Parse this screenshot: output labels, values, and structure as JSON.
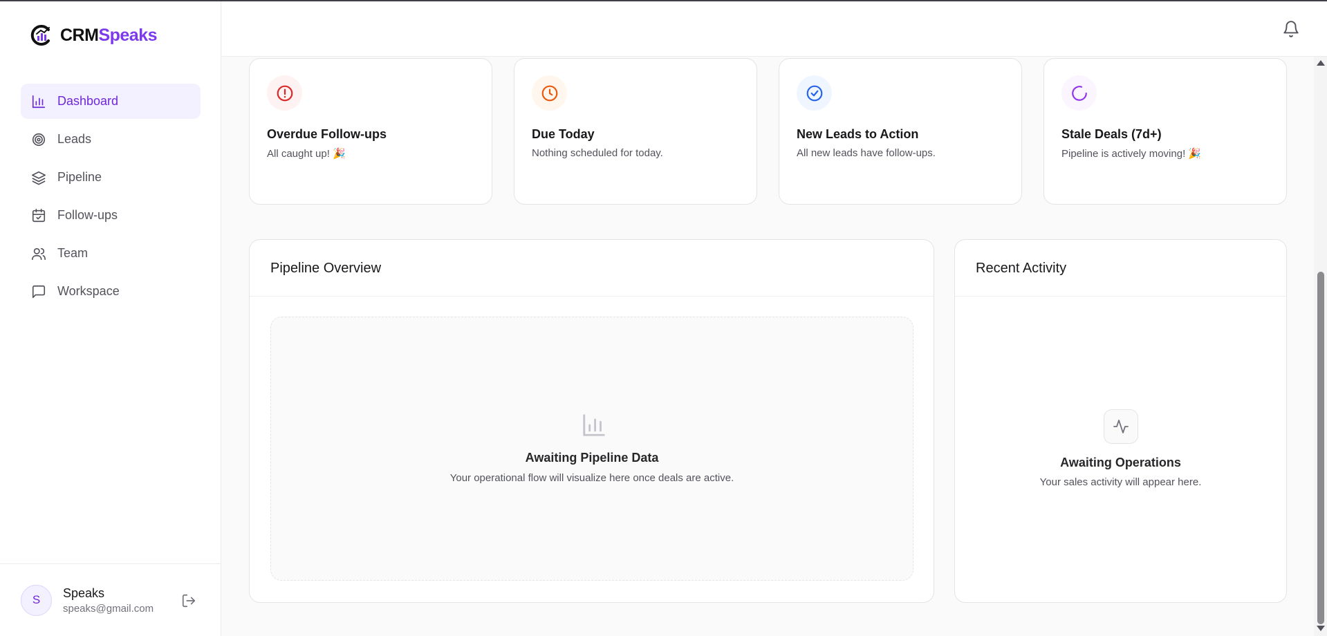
{
  "brand": {
    "part1": "CRM",
    "part2": "Speaks",
    "accent": "#7c3aed"
  },
  "nav": {
    "items": [
      {
        "label": "Dashboard",
        "icon": "bar-chart-icon",
        "active": true
      },
      {
        "label": "Leads",
        "icon": "target-icon"
      },
      {
        "label": "Pipeline",
        "icon": "layers-icon"
      },
      {
        "label": "Follow-ups",
        "icon": "calendar-check-icon"
      },
      {
        "label": "Team",
        "icon": "users-icon"
      },
      {
        "label": "Workspace",
        "icon": "message-square-icon"
      }
    ]
  },
  "user": {
    "initial": "S",
    "name": "Speaks",
    "email": "speaks@gmail.com"
  },
  "stats": [
    {
      "title": "Overdue Follow-ups",
      "subtitle": "All caught up! 🎉",
      "icon": "alert-circle-icon",
      "color": "#dc2626",
      "bg": "#fef2f2"
    },
    {
      "title": "Due Today",
      "subtitle": "Nothing scheduled for today.",
      "icon": "clock-icon",
      "color": "#ea580c",
      "bg": "#fff7ed"
    },
    {
      "title": "New Leads to Action",
      "subtitle": "All new leads have follow-ups.",
      "icon": "check-circle-icon",
      "color": "#2563eb",
      "bg": "#eff6ff"
    },
    {
      "title": "Stale Deals (7d+)",
      "subtitle": "Pipeline is actively moving! 🎉",
      "icon": "loader-icon",
      "color": "#9333ea",
      "bg": "#faf5ff"
    }
  ],
  "pipeline": {
    "title": "Pipeline Overview",
    "empty_title": "Awaiting Pipeline Data",
    "empty_sub": "Your operational flow will visualize here once deals are active."
  },
  "activity": {
    "title": "Recent Activity",
    "empty_title": "Awaiting Operations",
    "empty_sub": "Your sales activity will appear here."
  }
}
